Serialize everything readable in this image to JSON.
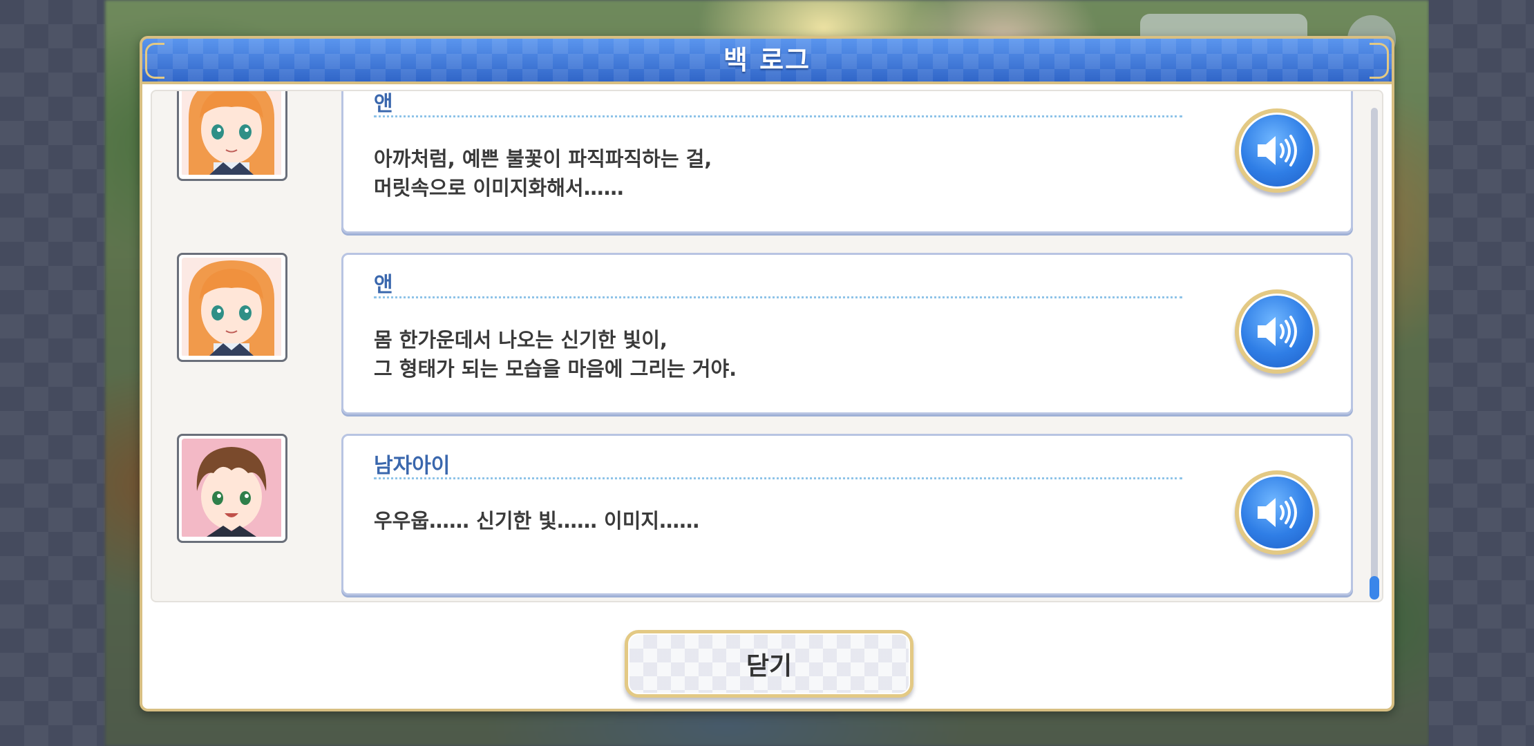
{
  "dialog": {
    "title": "백 로그",
    "close_label": "닫기"
  },
  "entries": [
    {
      "speaker": "앤",
      "lines": [
        "아까처럼, 예쁜 불꽃이 파직파직하는 걸,",
        "머릿속으로 이미지화해서……"
      ],
      "portrait": "orange-haired-girl"
    },
    {
      "speaker": "앤",
      "lines": [
        "몸 한가운데서 나오는 신기한 빛이,",
        "그 형태가 되는 모습을 마음에 그리는 거야."
      ],
      "portrait": "orange-haired-girl"
    },
    {
      "speaker": "남자아이",
      "lines": [
        "우우웁…… 신기한 빛…… 이미지……",
        ""
      ],
      "portrait": "brown-haired-boy"
    }
  ],
  "icons": {
    "voice": "speaker-icon"
  },
  "colors": {
    "title_bar": "#3d78d8",
    "frame_gold": "#d8bf82",
    "speaker_name": "#3a67ad",
    "voice_button": "#2f7ee6"
  }
}
